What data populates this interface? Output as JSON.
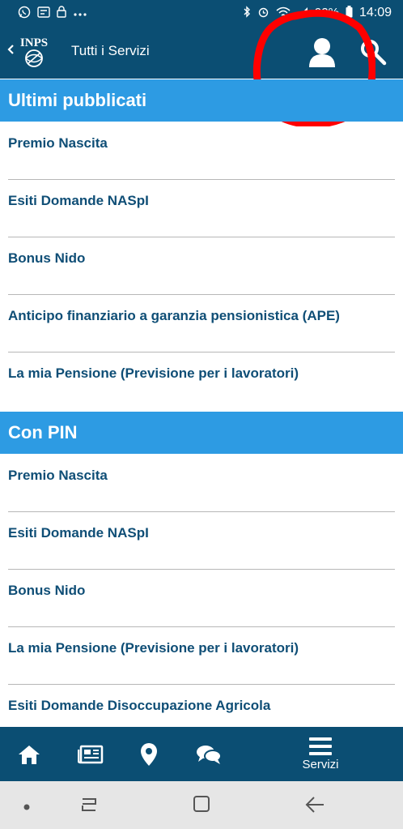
{
  "status_bar": {
    "icons_left": [
      "whatsapp-icon",
      "sim-icon",
      "lock-icon",
      "more-dots-icon"
    ],
    "icons_right": [
      "bluetooth-icon",
      "alarm-icon",
      "wifi-icon",
      "signal-icon",
      "battery-icon"
    ],
    "battery": "92%",
    "time": "14:09"
  },
  "app_bar": {
    "logo_text": "INPS",
    "title": "Tutti i Servizi"
  },
  "sections": [
    {
      "title": "Ultimi pubblicati",
      "items": [
        "Premio Nascita",
        "Esiti Domande NASpI",
        "Bonus Nido",
        "Anticipo finanziario a garanzia pensionistica (APE)",
        "La mia Pensione (Previsione per i lavoratori)"
      ]
    },
    {
      "title": "Con PIN",
      "items": [
        "Premio Nascita",
        "Esiti Domande NASpI",
        "Bonus Nido",
        "La mia Pensione (Previsione per i lavoratori)",
        "Esiti Domande Disoccupazione Agricola"
      ]
    }
  ],
  "bottom_nav": {
    "items": [
      {
        "icon": "home-icon",
        "label": ""
      },
      {
        "icon": "news-icon",
        "label": ""
      },
      {
        "icon": "location-pin-icon",
        "label": ""
      },
      {
        "icon": "chat-icon",
        "label": ""
      },
      {
        "icon": "menu-icon",
        "label": "Servizi"
      }
    ]
  },
  "colors": {
    "app_bar": "#0b4e73",
    "section_header": "#2d9be3",
    "item_text": "#0f4e76",
    "annotation": "#ff0000"
  }
}
